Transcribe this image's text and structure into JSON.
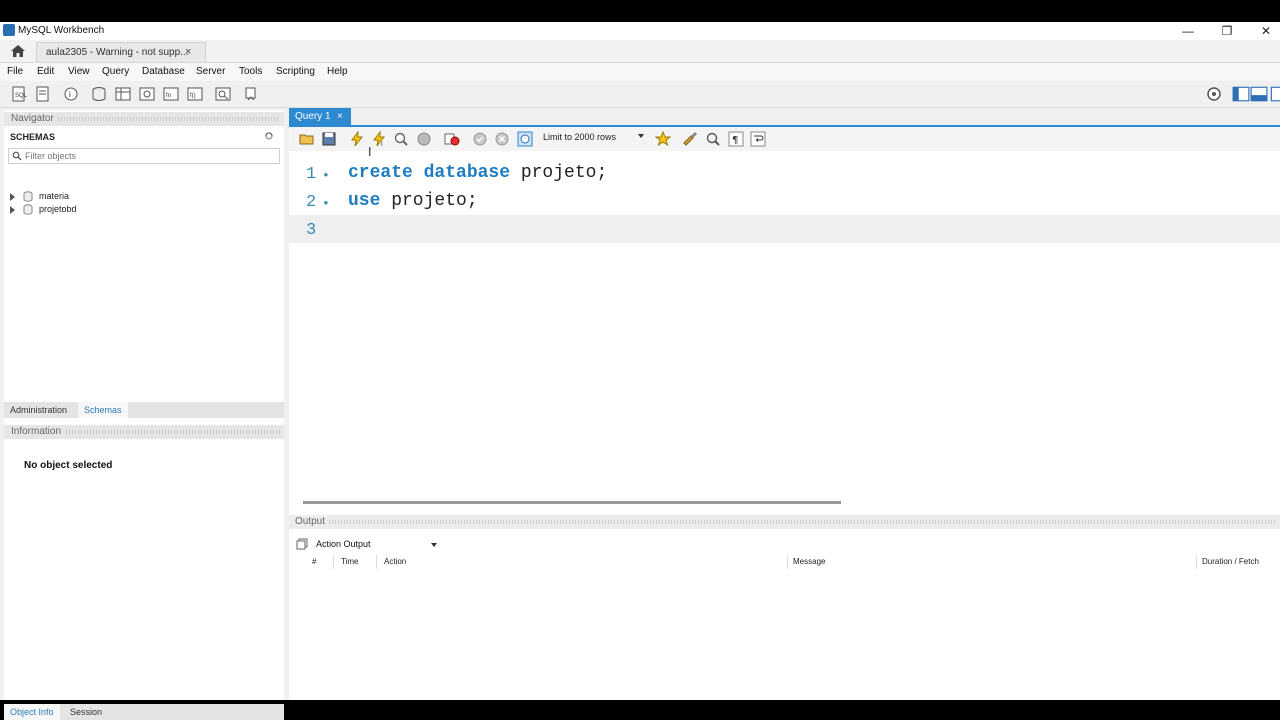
{
  "window": {
    "title": "MySQL Workbench",
    "minimize": "—",
    "restore": "❐",
    "close": "✕"
  },
  "connection_tab": {
    "label": "aula2305 - Warning - not supp...",
    "close": "×"
  },
  "menu": [
    "File",
    "Edit",
    "View",
    "Query",
    "Database",
    "Server",
    "Tools",
    "Scripting",
    "Help"
  ],
  "navigator": {
    "header": "Navigator",
    "schemas_title": "SCHEMAS",
    "filter_placeholder": "Filter objects",
    "schemas": [
      "materia",
      "projetobd"
    ],
    "tabs": [
      "Administration",
      "Schemas"
    ]
  },
  "information": {
    "header": "Information",
    "message": "No object selected",
    "tabs": [
      "Object Info",
      "Session"
    ]
  },
  "query_tab": {
    "label": "Query 1",
    "close": "×"
  },
  "query_toolbar": {
    "limit": "Limit to 2000 rows"
  },
  "editor": {
    "lines": [
      {
        "num": "1",
        "marker": "•",
        "keyword": "create database",
        "rest": " projeto;"
      },
      {
        "num": "2",
        "marker": "•",
        "keyword": "use",
        "rest": " projeto;"
      },
      {
        "num": "3",
        "marker": "",
        "keyword": "",
        "rest": ""
      }
    ]
  },
  "output": {
    "header": "Output",
    "selector": "Action Output",
    "columns": [
      "#",
      "Time",
      "Action",
      "Message",
      "Duration / Fetch"
    ]
  },
  "colors": {
    "accent": "#2e8ad0",
    "keyword": "#1f7dc2",
    "line_number": "#3a8bb0"
  }
}
